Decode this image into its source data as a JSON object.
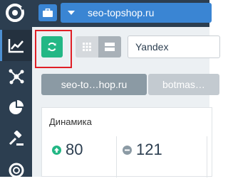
{
  "header": {
    "site_select_value": "seo-topshop.ru"
  },
  "toolbar": {
    "search_engine_value": "Yandex"
  },
  "tabs": [
    {
      "label": "seo-to…hop.ru"
    },
    {
      "label": "botmas…"
    }
  ],
  "card": {
    "title": "Динамика",
    "metrics": [
      {
        "value": "80",
        "direction": "up",
        "color": "#23b785"
      },
      {
        "value": "121",
        "direction": "neutral",
        "color": "#8b9aa4"
      }
    ]
  },
  "colors": {
    "rail": "#2c3e50",
    "accent_blue": "#3a85d3",
    "refresh_green": "#23b785",
    "highlight_red": "#e01f26"
  },
  "icons": [
    "logo-icon",
    "briefcase-icon",
    "chart-icon",
    "network-icon",
    "pie-chart-icon",
    "gavel-icon",
    "lifebuoy-icon",
    "refresh-icon",
    "grid-icon",
    "list-view-icon",
    "caret-down-icon",
    "arrow-up-circle-icon",
    "minus-circle-icon"
  ]
}
